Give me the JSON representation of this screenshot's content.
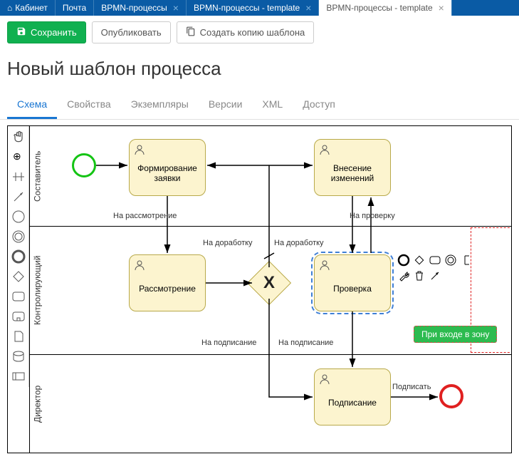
{
  "topbar": {
    "items": [
      {
        "label": "Кабинет"
      },
      {
        "label": "Почта"
      }
    ],
    "tabs": [
      {
        "label": "BPMN-процессы",
        "active": false
      },
      {
        "label": "BPMN-процессы - template",
        "active": false
      },
      {
        "label": "BPMN-процессы - template",
        "active": true
      }
    ]
  },
  "toolbar": {
    "save_label": "Сохранить",
    "publish_label": "Опубликовать",
    "copy_label": "Создать копию шаблона"
  },
  "title": "Новый шаблон процесса",
  "tabs": {
    "items": [
      {
        "label": "Схема",
        "active": true
      },
      {
        "label": "Свойства",
        "active": false
      },
      {
        "label": "Экземпляры",
        "active": false
      },
      {
        "label": "Версии",
        "active": false
      },
      {
        "label": "XML",
        "active": false
      },
      {
        "label": "Доступ",
        "active": false
      }
    ]
  },
  "lanes": [
    {
      "name": "Составитель"
    },
    {
      "name": "Контролирующий"
    },
    {
      "name": "Директор"
    }
  ],
  "tasks": {
    "form": "Формирование заявки",
    "changes": "Внесение изменений",
    "review": "Рассмотрение",
    "check": "Проверка",
    "sign": "Подписание"
  },
  "flows": {
    "to_review": "На рассмотрение",
    "to_rework1": "На доработку",
    "to_rework2": "На доработку",
    "to_check": "На проверку",
    "to_sign1": "На подписание",
    "to_sign2": "На подписание",
    "sign": "Подписать"
  },
  "zone_badge": "При входе в зону",
  "gateway_x": "X"
}
